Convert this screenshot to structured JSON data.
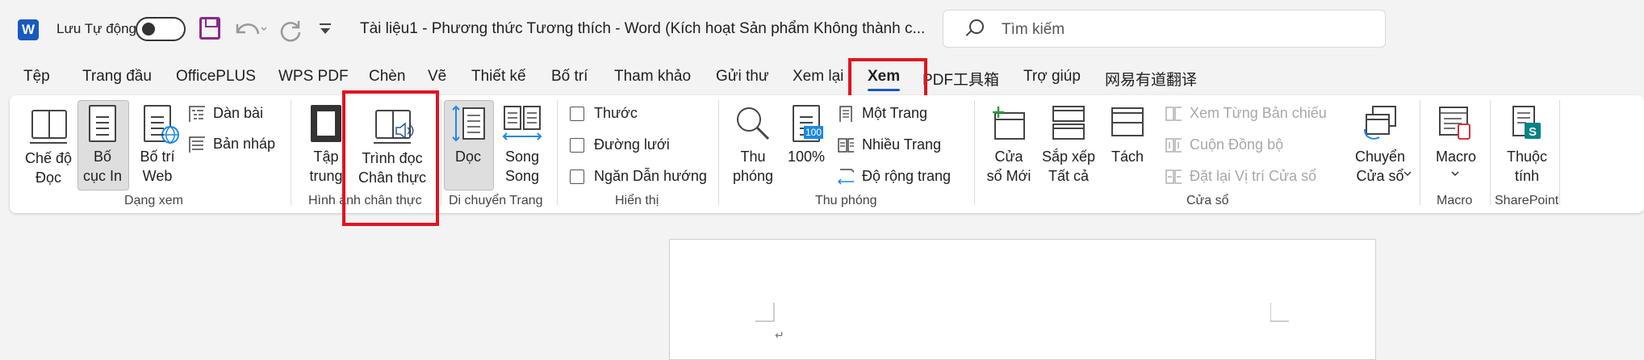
{
  "titlebar": {
    "autosave_label": "Lưu Tự động",
    "document_title": "Tài liệu1  -  Phương thức Tương thích  -  Word (Kích hoạt Sản phẩm Không thành c...",
    "search_placeholder": "Tìm kiếm"
  },
  "tabs": [
    {
      "label": "Tệp"
    },
    {
      "label": "Trang đầu"
    },
    {
      "label": "OfficePLUS"
    },
    {
      "label": "WPS PDF"
    },
    {
      "label": "Chèn"
    },
    {
      "label": "Vẽ"
    },
    {
      "label": "Thiết kế"
    },
    {
      "label": "Bố trí"
    },
    {
      "label": "Tham khảo"
    },
    {
      "label": "Gửi thư"
    },
    {
      "label": "Xem lại"
    },
    {
      "label": "Xem",
      "active": true
    },
    {
      "label": "PDF工具箱"
    },
    {
      "label": "Trợ giúp"
    },
    {
      "label": "网易有道翻译"
    }
  ],
  "ribbon": {
    "views": {
      "read_mode": "Chế độ\nĐọc",
      "print_layout": "Bố\ncục In",
      "web_layout": "Bố trí\nWeb",
      "outline": "Dàn bài",
      "draft": "Bản nháp",
      "group_label": "Dạng xem"
    },
    "immersive": {
      "focus": "Tập\ntrung",
      "immersive_reader": "Trình đọc\nChân thực",
      "group_label": "Hình ảnh chân thực"
    },
    "page_movement": {
      "vertical": "Dọc",
      "side_to_side": "Song\nSong",
      "group_label": "Di chuyển Trang"
    },
    "show": {
      "ruler": "Thước",
      "gridlines": "Đường lưới",
      "navigation_pane": "Ngăn Dẫn hướng",
      "group_label": "Hiển thị"
    },
    "zoom": {
      "zoom": "Thu\nphóng",
      "zoom_100": "100%",
      "zoom_100_icon_text": "100",
      "one_page": "Một Trang",
      "multiple_pages": "Nhiều Trang",
      "page_width": "Độ rộng trang",
      "group_label": "Thu phóng"
    },
    "window": {
      "new_window": "Cửa\nsổ Mới",
      "arrange_all": "Sắp xếp\nTất cả",
      "split": "Tách",
      "view_side_by_side": "Xem Từng Bản chiếu",
      "synchronous_scrolling": "Cuộn Đồng bộ",
      "reset_window_position": "Đặt lại Vị trí Cửa sổ",
      "switch_windows": "Chuyển\nCửa sổ",
      "group_label": "Cửa sổ"
    },
    "macros": {
      "macros": "Macro",
      "group_label": "Macro"
    },
    "sharepoint": {
      "properties": "Thuộc\ntính",
      "group_label": "SharePoint"
    }
  },
  "document": {
    "paragraph_mark": "↵"
  }
}
